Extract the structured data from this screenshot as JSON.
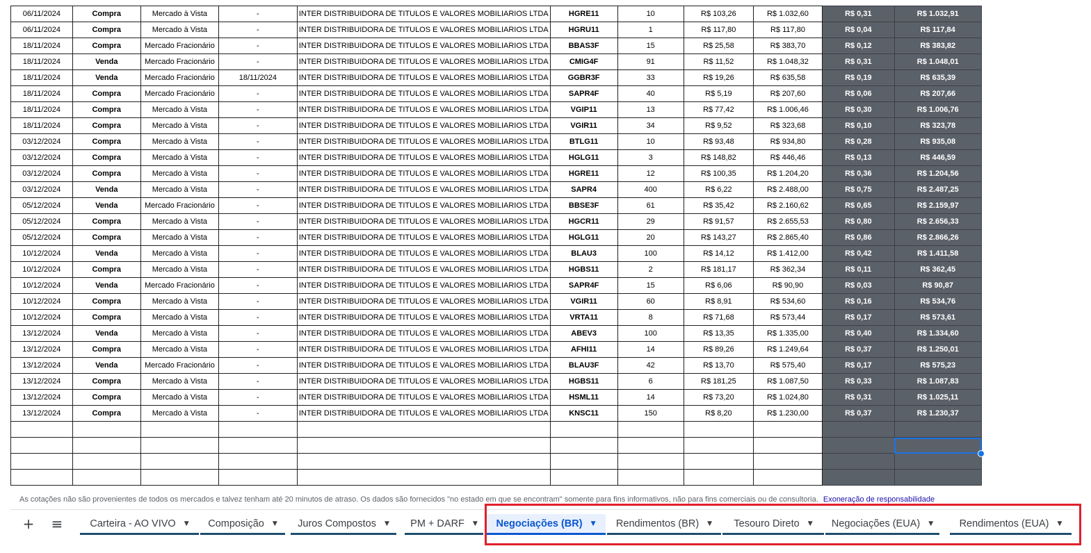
{
  "sheet": {
    "rows": [
      {
        "data": "06/11/2024",
        "tipo": "Compra",
        "mercado": "Mercado à Vista",
        "prazo": "-",
        "instituicao": "INTER DISTRIBUIDORA DE TITULOS E VALORES MOBILIARIOS LTDA",
        "codigo": "HGRE11",
        "quantidade": "10",
        "preco": "R$ 103,26",
        "valor": "R$ 1.032,60",
        "taxas": "R$ 0,31",
        "total": "R$ 1.032,91"
      },
      {
        "data": "06/11/2024",
        "tipo": "Compra",
        "mercado": "Mercado à Vista",
        "prazo": "-",
        "instituicao": "INTER DISTRIBUIDORA DE TITULOS E VALORES MOBILIARIOS LTDA",
        "codigo": "HGRU11",
        "quantidade": "1",
        "preco": "R$ 117,80",
        "valor": "R$ 117,80",
        "taxas": "R$ 0,04",
        "total": "R$ 117,84"
      },
      {
        "data": "18/11/2024",
        "tipo": "Compra",
        "mercado": "Mercado Fracionário",
        "prazo": "-",
        "instituicao": "INTER DISTRIBUIDORA DE TITULOS E VALORES MOBILIARIOS LTDA",
        "codigo": "BBAS3F",
        "quantidade": "15",
        "preco": "R$ 25,58",
        "valor": "R$ 383,70",
        "taxas": "R$ 0,12",
        "total": "R$ 383,82"
      },
      {
        "data": "18/11/2024",
        "tipo": "Venda",
        "mercado": "Mercado Fracionário",
        "prazo": "-",
        "instituicao": "INTER DISTRIBUIDORA DE TITULOS E VALORES MOBILIARIOS LTDA",
        "codigo": "CMIG4F",
        "quantidade": "91",
        "preco": "R$ 11,52",
        "valor": "R$ 1.048,32",
        "taxas": "R$ 0,31",
        "total": "R$ 1.048,01"
      },
      {
        "data": "18/11/2024",
        "tipo": "Venda",
        "mercado": "Mercado Fracionário",
        "prazo": "18/11/2024",
        "instituicao": "INTER DISTRIBUIDORA DE TITULOS E VALORES MOBILIARIOS LTDA",
        "codigo": "GGBR3F",
        "quantidade": "33",
        "preco": "R$ 19,26",
        "valor": "R$ 635,58",
        "taxas": "R$ 0,19",
        "total": "R$ 635,39"
      },
      {
        "data": "18/11/2024",
        "tipo": "Compra",
        "mercado": "Mercado Fracionário",
        "prazo": "-",
        "instituicao": "INTER DISTRIBUIDORA DE TITULOS E VALORES MOBILIARIOS LTDA",
        "codigo": "SAPR4F",
        "quantidade": "40",
        "preco": "R$ 5,19",
        "valor": "R$ 207,60",
        "taxas": "R$ 0,06",
        "total": "R$ 207,66"
      },
      {
        "data": "18/11/2024",
        "tipo": "Compra",
        "mercado": "Mercado à Vista",
        "prazo": "-",
        "instituicao": "INTER DISTRIBUIDORA DE TITULOS E VALORES MOBILIARIOS LTDA",
        "codigo": "VGIP11",
        "quantidade": "13",
        "preco": "R$ 77,42",
        "valor": "R$ 1.006,46",
        "taxas": "R$ 0,30",
        "total": "R$ 1.006,76"
      },
      {
        "data": "18/11/2024",
        "tipo": "Compra",
        "mercado": "Mercado à Vista",
        "prazo": "-",
        "instituicao": "INTER DISTRIBUIDORA DE TITULOS E VALORES MOBILIARIOS LTDA",
        "codigo": "VGIR11",
        "quantidade": "34",
        "preco": "R$ 9,52",
        "valor": "R$ 323,68",
        "taxas": "R$ 0,10",
        "total": "R$ 323,78"
      },
      {
        "data": "03/12/2024",
        "tipo": "Compra",
        "mercado": "Mercado à Vista",
        "prazo": "-",
        "instituicao": "INTER DISTRIBUIDORA DE TITULOS E VALORES MOBILIARIOS LTDA",
        "codigo": "BTLG11",
        "quantidade": "10",
        "preco": "R$ 93,48",
        "valor": "R$ 934,80",
        "taxas": "R$ 0,28",
        "total": "R$ 935,08"
      },
      {
        "data": "03/12/2024",
        "tipo": "Compra",
        "mercado": "Mercado à Vista",
        "prazo": "-",
        "instituicao": "INTER DISTRIBUIDORA DE TITULOS E VALORES MOBILIARIOS LTDA",
        "codigo": "HGLG11",
        "quantidade": "3",
        "preco": "R$ 148,82",
        "valor": "R$ 446,46",
        "taxas": "R$ 0,13",
        "total": "R$ 446,59"
      },
      {
        "data": "03/12/2024",
        "tipo": "Compra",
        "mercado": "Mercado à Vista",
        "prazo": "-",
        "instituicao": "INTER DISTRIBUIDORA DE TITULOS E VALORES MOBILIARIOS LTDA",
        "codigo": "HGRE11",
        "quantidade": "12",
        "preco": "R$ 100,35",
        "valor": "R$ 1.204,20",
        "taxas": "R$ 0,36",
        "total": "R$ 1.204,56"
      },
      {
        "data": "03/12/2024",
        "tipo": "Venda",
        "mercado": "Mercado à Vista",
        "prazo": "-",
        "instituicao": "INTER DISTRIBUIDORA DE TITULOS E VALORES MOBILIARIOS LTDA",
        "codigo": "SAPR4",
        "quantidade": "400",
        "preco": "R$ 6,22",
        "valor": "R$ 2.488,00",
        "taxas": "R$ 0,75",
        "total": "R$ 2.487,25"
      },
      {
        "data": "05/12/2024",
        "tipo": "Venda",
        "mercado": "Mercado Fracionário",
        "prazo": "-",
        "instituicao": "INTER DISTRIBUIDORA DE TITULOS E VALORES MOBILIARIOS LTDA",
        "codigo": "BBSE3F",
        "quantidade": "61",
        "preco": "R$ 35,42",
        "valor": "R$ 2.160,62",
        "taxas": "R$ 0,65",
        "total": "R$ 2.159,97"
      },
      {
        "data": "05/12/2024",
        "tipo": "Compra",
        "mercado": "Mercado à Vista",
        "prazo": "-",
        "instituicao": "INTER DISTRIBUIDORA DE TITULOS E VALORES MOBILIARIOS LTDA",
        "codigo": "HGCR11",
        "quantidade": "29",
        "preco": "R$ 91,57",
        "valor": "R$ 2.655,53",
        "taxas": "R$ 0,80",
        "total": "R$ 2.656,33"
      },
      {
        "data": "05/12/2024",
        "tipo": "Compra",
        "mercado": "Mercado à Vista",
        "prazo": "-",
        "instituicao": "INTER DISTRIBUIDORA DE TITULOS E VALORES MOBILIARIOS LTDA",
        "codigo": "HGLG11",
        "quantidade": "20",
        "preco": "R$ 143,27",
        "valor": "R$ 2.865,40",
        "taxas": "R$ 0,86",
        "total": "R$ 2.866,26"
      },
      {
        "data": "10/12/2024",
        "tipo": "Venda",
        "mercado": "Mercado à Vista",
        "prazo": "-",
        "instituicao": "INTER DISTRIBUIDORA DE TITULOS E VALORES MOBILIARIOS LTDA",
        "codigo": "BLAU3",
        "quantidade": "100",
        "preco": "R$ 14,12",
        "valor": "R$ 1.412,00",
        "taxas": "R$ 0,42",
        "total": "R$ 1.411,58"
      },
      {
        "data": "10/12/2024",
        "tipo": "Compra",
        "mercado": "Mercado à Vista",
        "prazo": "-",
        "instituicao": "INTER DISTRIBUIDORA DE TITULOS E VALORES MOBILIARIOS LTDA",
        "codigo": "HGBS11",
        "quantidade": "2",
        "preco": "R$ 181,17",
        "valor": "R$ 362,34",
        "taxas": "R$ 0,11",
        "total": "R$ 362,45"
      },
      {
        "data": "10/12/2024",
        "tipo": "Venda",
        "mercado": "Mercado Fracionário",
        "prazo": "-",
        "instituicao": "INTER DISTRIBUIDORA DE TITULOS E VALORES MOBILIARIOS LTDA",
        "codigo": "SAPR4F",
        "quantidade": "15",
        "preco": "R$ 6,06",
        "valor": "R$ 90,90",
        "taxas": "R$ 0,03",
        "total": "R$ 90,87"
      },
      {
        "data": "10/12/2024",
        "tipo": "Compra",
        "mercado": "Mercado à Vista",
        "prazo": "-",
        "instituicao": "INTER DISTRIBUIDORA DE TITULOS E VALORES MOBILIARIOS LTDA",
        "codigo": "VGIR11",
        "quantidade": "60",
        "preco": "R$ 8,91",
        "valor": "R$ 534,60",
        "taxas": "R$ 0,16",
        "total": "R$ 534,76"
      },
      {
        "data": "10/12/2024",
        "tipo": "Compra",
        "mercado": "Mercado à Vista",
        "prazo": "-",
        "instituicao": "INTER DISTRIBUIDORA DE TITULOS E VALORES MOBILIARIOS LTDA",
        "codigo": "VRTA11",
        "quantidade": "8",
        "preco": "R$ 71,68",
        "valor": "R$ 573,44",
        "taxas": "R$ 0,17",
        "total": "R$ 573,61"
      },
      {
        "data": "13/12/2024",
        "tipo": "Venda",
        "mercado": "Mercado à Vista",
        "prazo": "-",
        "instituicao": "INTER DISTRIBUIDORA DE TITULOS E VALORES MOBILIARIOS LTDA",
        "codigo": "ABEV3",
        "quantidade": "100",
        "preco": "R$ 13,35",
        "valor": "R$ 1.335,00",
        "taxas": "R$ 0,40",
        "total": "R$ 1.334,60"
      },
      {
        "data": "13/12/2024",
        "tipo": "Compra",
        "mercado": "Mercado à Vista",
        "prazo": "-",
        "instituicao": "INTER DISTRIBUIDORA DE TITULOS E VALORES MOBILIARIOS LTDA",
        "codigo": "AFHI11",
        "quantidade": "14",
        "preco": "R$ 89,26",
        "valor": "R$ 1.249,64",
        "taxas": "R$ 0,37",
        "total": "R$ 1.250,01"
      },
      {
        "data": "13/12/2024",
        "tipo": "Venda",
        "mercado": "Mercado Fracionário",
        "prazo": "-",
        "instituicao": "INTER DISTRIBUIDORA DE TITULOS E VALORES MOBILIARIOS LTDA",
        "codigo": "BLAU3F",
        "quantidade": "42",
        "preco": "R$ 13,70",
        "valor": "R$ 575,40",
        "taxas": "R$ 0,17",
        "total": "R$ 575,23"
      },
      {
        "data": "13/12/2024",
        "tipo": "Compra",
        "mercado": "Mercado à Vista",
        "prazo": "-",
        "instituicao": "INTER DISTRIBUIDORA DE TITULOS E VALORES MOBILIARIOS LTDA",
        "codigo": "HGBS11",
        "quantidade": "6",
        "preco": "R$ 181,25",
        "valor": "R$ 1.087,50",
        "taxas": "R$ 0,33",
        "total": "R$ 1.087,83"
      },
      {
        "data": "13/12/2024",
        "tipo": "Compra",
        "mercado": "Mercado à Vista",
        "prazo": "-",
        "instituicao": "INTER DISTRIBUIDORA DE TITULOS E VALORES MOBILIARIOS LTDA",
        "codigo": "HSML11",
        "quantidade": "14",
        "preco": "R$ 73,20",
        "valor": "R$ 1.024,80",
        "taxas": "R$ 0,31",
        "total": "R$ 1.025,11"
      },
      {
        "data": "13/12/2024",
        "tipo": "Compra",
        "mercado": "Mercado à Vista",
        "prazo": "-",
        "instituicao": "INTER DISTRIBUIDORA DE TITULOS E VALORES MOBILIARIOS LTDA",
        "codigo": "KNSC11",
        "quantidade": "150",
        "preco": "R$ 8,20",
        "valor": "R$ 1.230,00",
        "taxas": "R$ 0,37",
        "total": "R$ 1.230,37"
      }
    ],
    "empty_rows": 4,
    "colors": {
      "compra": "#1a9e35",
      "venda": "#e01616",
      "dark_column": "#5b6169",
      "selection": "#1a73e8"
    }
  },
  "disclaimer": {
    "text": "As cotações não são provenientes de todos os mercados e talvez tenham até 20 minutos de atraso. Os dados são fornecidos \"no estado em que se encontram\" somente para fins informativos, não para fins comerciais ou de consultoria.",
    "link": "Exoneração de responsabilidade"
  },
  "tabbar": {
    "add_icon": "plus-icon",
    "menu_icon": "hamburger-menu-icon",
    "tabs": [
      {
        "label": "Carteira - AO VIVO",
        "active": false
      },
      {
        "label": "Composição",
        "active": false
      },
      {
        "label": "Juros Compostos",
        "active": false
      },
      {
        "label": "PM + DARF",
        "active": false
      },
      {
        "label": "Negociações (BR)",
        "active": true
      },
      {
        "label": "Rendimentos (BR)",
        "active": false
      },
      {
        "label": "Tesouro Direto",
        "active": false
      },
      {
        "label": "Negociações (EUA)",
        "active": false
      },
      {
        "label": "Rendimentos (EUA)",
        "active": false
      }
    ],
    "highlight_color": "#e1202a"
  }
}
